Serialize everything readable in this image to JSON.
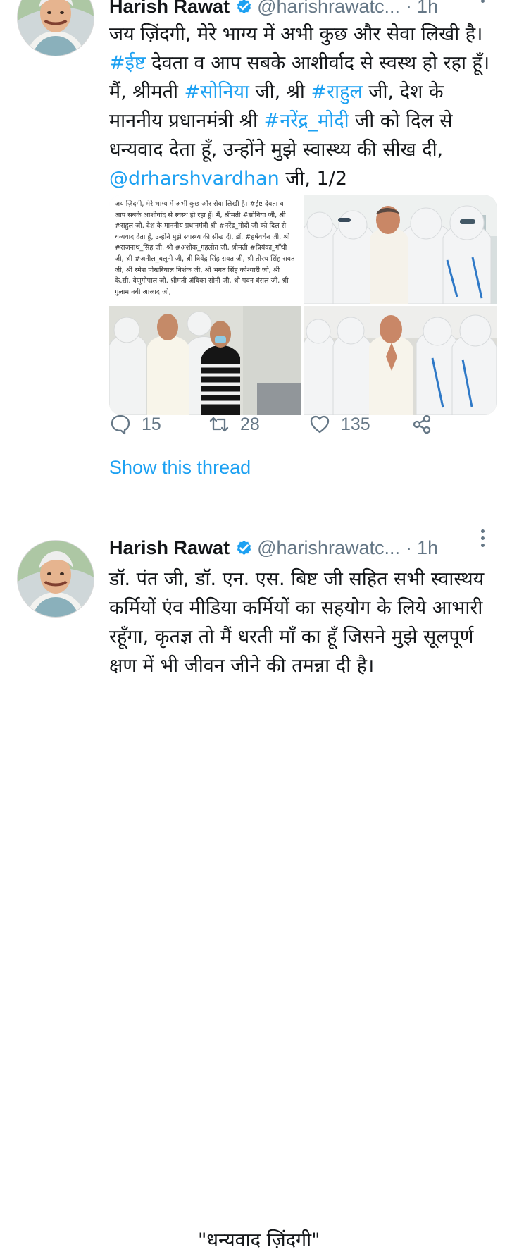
{
  "tweet1": {
    "name": "Harish Rawat",
    "handle": "@harishrawatc...",
    "separator": "·",
    "time": "1h",
    "text_parts": [
      "जय ज़िंदगी, मेरे भाग्य में अभी कुछ और सेवा लिखी है। ",
      "#ईष्ट",
      " देवता व आप सबके आशीर्वाद से स्वस्थ हो रहा हूँ। मैं, श्रीमती ",
      "#सोनिया",
      " जी, श्री ",
      "#राहुल",
      " जी, देश के माननीय प्रधानमंत्री श्री ",
      "#नरेंद्र_मोदी",
      " जी को दिल से धन्यवाद देता हूँ, उन्होंने मुझे स्वास्थ्य की सीख दी, ",
      "@drharshvardhan",
      " जी, 1/2"
    ],
    "media_note": "जय ज़िंदगी, मेरे भाग्य में अभी कुछ और सेवा लिखी है। #ईष्ट देवता व आप सबके आशीर्वाद से स्वस्थ हो रहा हूँ। मैं, श्रीमती #सोनिया जी, श्री #राहुल जी, देश के माननीय प्रधानमंत्री श्री #नरेंद्र_मोदी जी को दिल से धन्यवाद देता हूँ, उन्होंने मुझे स्वास्थ्य की सीख दी, डॉ. #हर्षवर्धन जी, श्री #राजनाथ_सिंह जी, श्री #अशोक_गहलोत जी, श्रीमती #प्रियंका_गाँधी जी, श्री #अनील_बलूनी जी, श्री त्रिवेंद्र सिंह रावत जी, श्री तीरथ सिंह रावत जी, श्री रमेश पोखरियाल निशंक जी, श्री भगत सिंह कोश्यारी जी, श्री के.सी. वेणुगोपाल जी, श्रीमती अंबिका सोनी जी, श्री पवन बंसल जी, श्री गुलाम नबी आजाद जी,",
    "actions": {
      "reply_count": "15",
      "retweet_count": "28",
      "like_count": "135"
    },
    "thread_link": "Show this thread"
  },
  "tweet2": {
    "name": "Harish Rawat",
    "handle": "@harishrawatc...",
    "separator": "·",
    "time": "1h",
    "text": "डॉ. पंत जी, डॉ. एन. एस. बिष्ट जी सहित सभी स्वास्थय कर्मियों एंव मीडिया कर्मियों का सहयोग के लिये आभारी रहूँगा, कृतज्ञ तो मैं धरती माँ का हूँ जिसने मुझे सूलपूर्ण क्षण में भी जीवन जीने की तमन्ना दी है।",
    "quote": "\"धन्यवाद ज़िंदगी\""
  },
  "colors": {
    "link": "#1da1f2",
    "secondary": "#657786",
    "text": "#14171a",
    "divider": "#e6ecf0"
  },
  "icons": [
    "verified-badge-icon",
    "more-options-icon",
    "reply-icon",
    "retweet-icon",
    "like-icon",
    "share-icon"
  ]
}
